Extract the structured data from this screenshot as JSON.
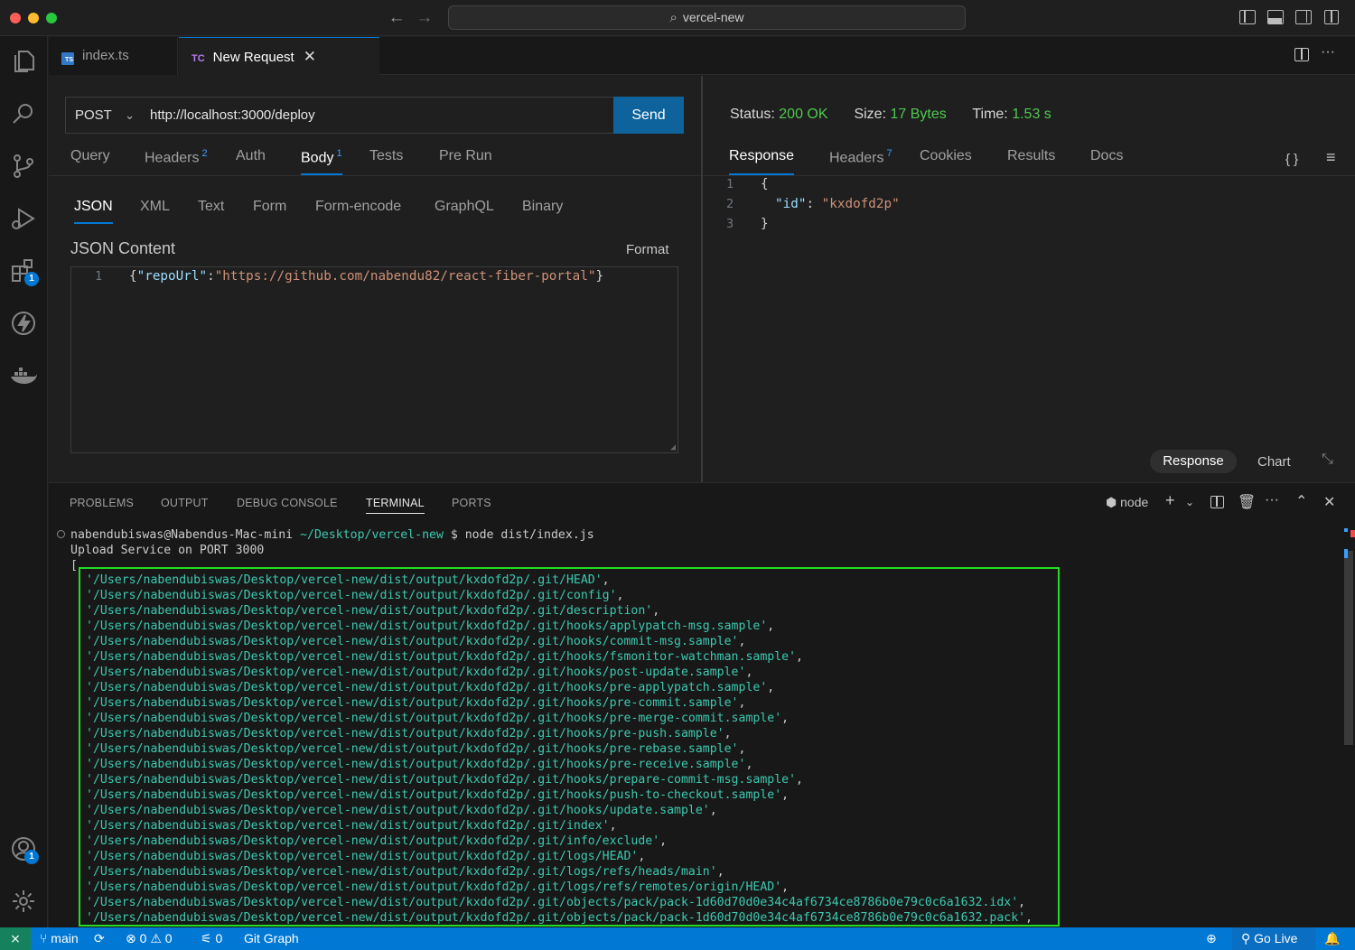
{
  "window": {
    "search_text": "vercel-new"
  },
  "tabs": [
    {
      "label": "index.ts"
    },
    {
      "label": "New Request",
      "icon_text": "TC"
    }
  ],
  "request": {
    "method": "POST",
    "url": "http://localhost:3000/deploy",
    "send_label": "Send",
    "tabs": [
      {
        "label": "Query"
      },
      {
        "label": "Headers",
        "count": "2"
      },
      {
        "label": "Auth"
      },
      {
        "label": "Body",
        "count": "1"
      },
      {
        "label": "Tests"
      },
      {
        "label": "Pre Run"
      }
    ],
    "body_types": [
      "JSON",
      "XML",
      "Text",
      "Form",
      "Form-encode",
      "GraphQL",
      "Binary"
    ],
    "json_title": "JSON Content",
    "format_label": "Format",
    "json_line_number": "1",
    "json_key": "\"repoUrl\"",
    "json_value": "\"https://github.com/nabendu82/react-fiber-portal\""
  },
  "response": {
    "status_label": "Status:",
    "status_value": "200 OK",
    "size_label": "Size:",
    "size_value": "17 Bytes",
    "time_label": "Time:",
    "time_value": "1.53 s",
    "tabs": [
      {
        "label": "Response"
      },
      {
        "label": "Headers",
        "count": "7"
      },
      {
        "label": "Cookies"
      },
      {
        "label": "Results"
      },
      {
        "label": "Docs"
      }
    ],
    "body_key": "\"id\"",
    "body_value": "\"kxdofd2p\"",
    "view_response": "Response",
    "view_chart": "Chart"
  },
  "panel": {
    "tabs": [
      "PROBLEMS",
      "OUTPUT",
      "DEBUG CONSOLE",
      "TERMINAL",
      "PORTS"
    ],
    "shell_label": "node",
    "prompt_user": "nabendubiswas@Nabendus-Mac-mini",
    "prompt_path": "~/Desktop/vercel-new",
    "prompt_cmd": "$ node dist/index.js",
    "output_line": "Upload Service on PORT 3000",
    "array_open": "[",
    "file_prefix": "/Users/nabendubiswas/Desktop/vercel-new/dist/output/kxdofd2p/",
    "files": [
      ".git/HEAD",
      ".git/config",
      ".git/description",
      ".git/hooks/applypatch-msg.sample",
      ".git/hooks/commit-msg.sample",
      ".git/hooks/fsmonitor-watchman.sample",
      ".git/hooks/post-update.sample",
      ".git/hooks/pre-applypatch.sample",
      ".git/hooks/pre-commit.sample",
      ".git/hooks/pre-merge-commit.sample",
      ".git/hooks/pre-push.sample",
      ".git/hooks/pre-rebase.sample",
      ".git/hooks/pre-receive.sample",
      ".git/hooks/prepare-commit-msg.sample",
      ".git/hooks/push-to-checkout.sample",
      ".git/hooks/update.sample",
      ".git/index",
      ".git/info/exclude",
      ".git/logs/HEAD",
      ".git/logs/refs/heads/main",
      ".git/logs/refs/remotes/origin/HEAD",
      ".git/objects/pack/pack-1d60d70d0e34c4af6734ce8786b0e79c0c6a1632.idx",
      ".git/objects/pack/pack-1d60d70d0e34c4af6734ce8786b0e79c0c6a1632.pack"
    ]
  },
  "activity_badges": {
    "extensions": "1",
    "accounts": "1"
  },
  "statusbar": {
    "branch": "main",
    "errors": "0",
    "warnings": "0",
    "ports": "0",
    "git_graph": "Git Graph",
    "go_live": "Go Live"
  },
  "colors": {
    "accent": "#0078d4",
    "status_ok": "#4ec94e",
    "terminal_path": "#3dc9b0",
    "highlight_box": "#22dd22"
  }
}
